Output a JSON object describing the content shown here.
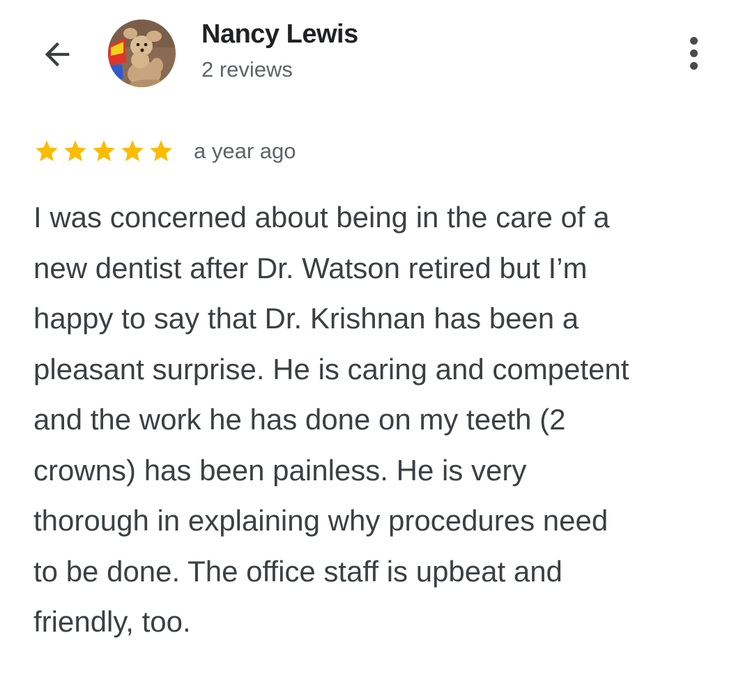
{
  "header": {
    "reviewer_name": "Nancy Lewis",
    "review_count": "2 reviews",
    "back_icon": "arrow-back-icon",
    "more_icon": "more-vert-icon"
  },
  "review": {
    "rating": 5,
    "rating_max": 5,
    "star_color": "#fbbc04",
    "date": "a year ago",
    "text_lines": [
      "I was concerned about being in the care of a",
      "new dentist after Dr. Watson retired but I’m",
      "happy to say that Dr. Krishnan has been a",
      "pleasant surprise. He is caring and competent",
      "and the work he has done on my teeth (2",
      "crowns) has been painless. He is very",
      "thorough in explaining why procedures need",
      "to be done. The office staff is upbeat and",
      "friendly, too."
    ]
  }
}
